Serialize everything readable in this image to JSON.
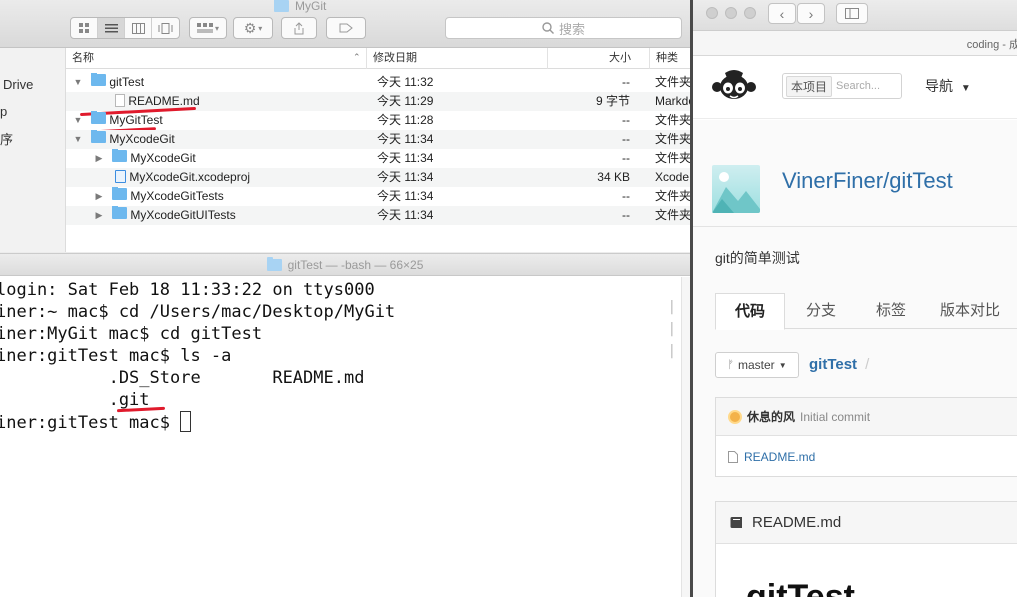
{
  "finder": {
    "title": "MyGit",
    "search_placeholder": "搜索",
    "sidebar": [
      {
        "label": "Drive"
      },
      {
        "label": "p"
      },
      {
        "label": "序"
      }
    ],
    "columns": [
      "名称",
      "修改日期",
      "大小",
      "种类"
    ],
    "rows": [
      {
        "name": "gitTest",
        "date": "今天 11:32",
        "size": "--",
        "kind": "文件夹"
      },
      {
        "name": "README.md",
        "date": "今天 11:29",
        "size": "9 字节",
        "kind": "Markdown"
      },
      {
        "name": "MyGitTest",
        "date": "今天 11:28",
        "size": "--",
        "kind": "文件夹"
      },
      {
        "name": "MyXcodeGit",
        "date": "今天 11:34",
        "size": "--",
        "kind": "文件夹"
      },
      {
        "name": "MyXcodeGit",
        "date": "今天 11:34",
        "size": "--",
        "kind": "文件夹"
      },
      {
        "name": "MyXcodeGit.xcodeproj",
        "date": "今天 11:34",
        "size": "34 KB",
        "kind": "Xcode"
      },
      {
        "name": "MyXcodeGitTests",
        "date": "今天 11:34",
        "size": "--",
        "kind": "文件夹"
      },
      {
        "name": "MyXcodeGitUITests",
        "date": "今天 11:34",
        "size": "--",
        "kind": "文件夹"
      }
    ]
  },
  "terminal": {
    "title": "gitTest — -bash — 66×25",
    "lines": [
      "login: Sat Feb 18 11:33:22 on ttys000",
      "iner:~ mac$ cd /Users/mac/Desktop/MyGit",
      "iner:MyGit mac$ cd gitTest",
      "iner:gitTest mac$ ls -a",
      "           .DS_Store       README.md",
      "           .git",
      "iner:gitTest mac$ "
    ]
  },
  "browser": {
    "url_text": "coding - 成",
    "search_scope": "本项目",
    "search_placeholder": "Search...",
    "nav_label": "导航",
    "repo_name": "VinerFiner/gitTest",
    "repo_desc": "git的简单测试",
    "tabs": [
      "代码",
      "分支",
      "标签",
      "版本对比"
    ],
    "branch": "master",
    "path": "gitTest",
    "path_sep": "/",
    "commit_author": "休息的风",
    "commit_message": "Initial commit",
    "file_name": "README.md",
    "readme_label": "README.md",
    "readme_heading": "gitTest"
  }
}
